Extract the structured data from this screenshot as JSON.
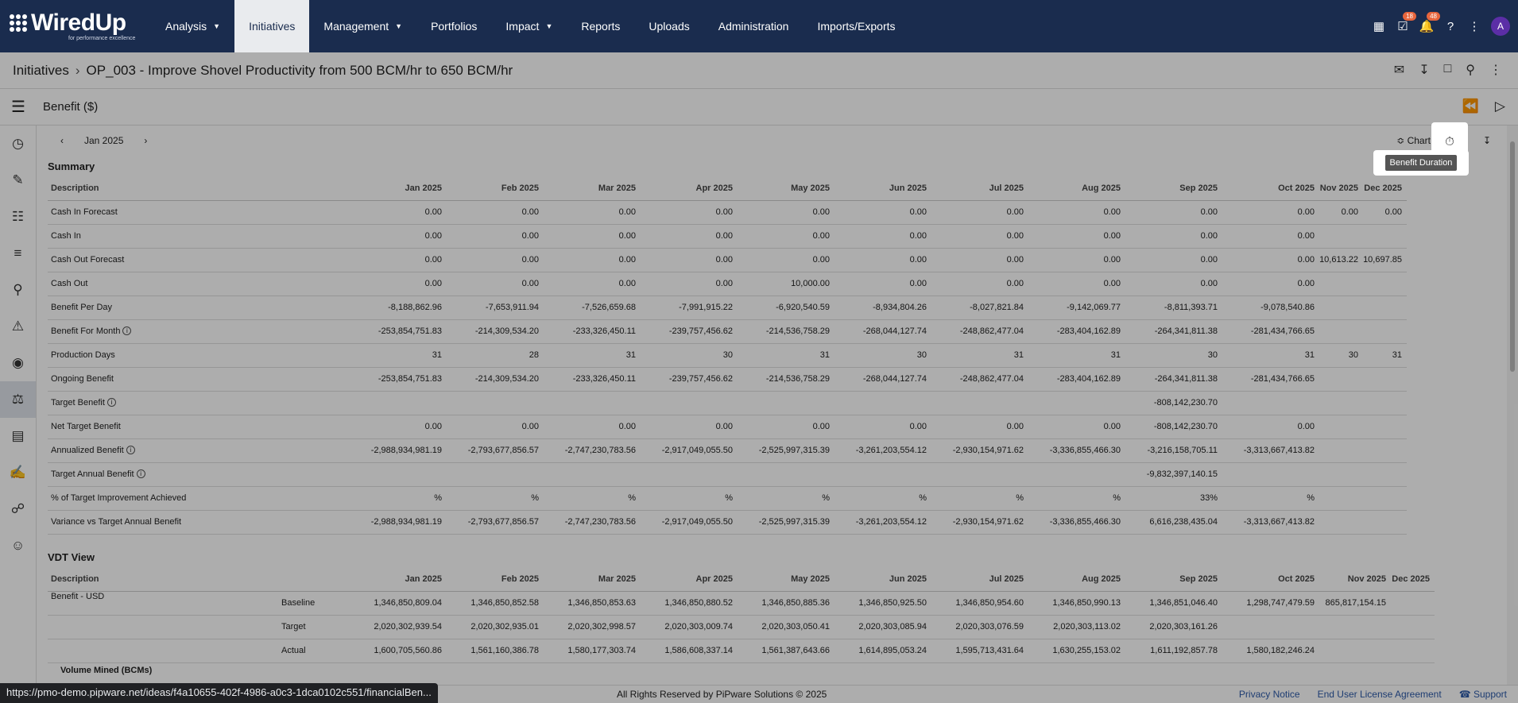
{
  "app": {
    "logo": "WiredUp",
    "tagline": "for performance excellence"
  },
  "nav": [
    {
      "label": "Analysis",
      "caret": true
    },
    {
      "label": "Initiatives",
      "caret": false,
      "active": true
    },
    {
      "label": "Management",
      "caret": true
    },
    {
      "label": "Portfolios",
      "caret": false
    },
    {
      "label": "Impact",
      "caret": true
    },
    {
      "label": "Reports",
      "caret": false
    },
    {
      "label": "Uploads",
      "caret": false
    },
    {
      "label": "Administration",
      "caret": false
    },
    {
      "label": "Imports/Exports",
      "caret": false
    }
  ],
  "top_icons": {
    "tasks_badge": "18",
    "alerts_badge": "48",
    "avatar": "A"
  },
  "breadcrumb": {
    "root": "Initiatives",
    "current": "OP_003 - Improve Shovel Productivity from 500 BCM/hr to 650 BCM/hr"
  },
  "subbar": {
    "title": "Benefit ($)"
  },
  "period": {
    "label": "Jan 2025"
  },
  "toolbar": {
    "chart_label": "Chart",
    "tooltip": "Benefit Duration"
  },
  "summary": {
    "title": "Summary",
    "columns": [
      "Description",
      "Jan 2025",
      "Feb 2025",
      "Mar 2025",
      "Apr 2025",
      "May 2025",
      "Jun 2025",
      "Jul 2025",
      "Aug 2025",
      "Sep 2025",
      "Oct 2025",
      "Nov 2025",
      "Dec 2025"
    ],
    "rows": [
      {
        "label": "Cash In Forecast",
        "info": false,
        "values": [
          "0.00",
          "0.00",
          "0.00",
          "0.00",
          "0.00",
          "0.00",
          "0.00",
          "0.00",
          "0.00",
          "0.00",
          "0.00",
          "0.00"
        ]
      },
      {
        "label": "Cash In",
        "info": false,
        "values": [
          "0.00",
          "0.00",
          "0.00",
          "0.00",
          "0.00",
          "0.00",
          "0.00",
          "0.00",
          "0.00",
          "0.00",
          "",
          ""
        ]
      },
      {
        "label": "Cash Out Forecast",
        "info": false,
        "values": [
          "0.00",
          "0.00",
          "0.00",
          "0.00",
          "0.00",
          "0.00",
          "0.00",
          "0.00",
          "0.00",
          "0.00",
          "10,613.22",
          "10,697.85"
        ]
      },
      {
        "label": "Cash Out",
        "info": false,
        "values": [
          "0.00",
          "0.00",
          "0.00",
          "0.00",
          "10,000.00",
          "0.00",
          "0.00",
          "0.00",
          "0.00",
          "0.00",
          "",
          ""
        ]
      },
      {
        "label": "Benefit Per Day",
        "info": false,
        "values": [
          "-8,188,862.96",
          "-7,653,911.94",
          "-7,526,659.68",
          "-7,991,915.22",
          "-6,920,540.59",
          "-8,934,804.26",
          "-8,027,821.84",
          "-9,142,069.77",
          "-8,811,393.71",
          "-9,078,540.86",
          "",
          ""
        ]
      },
      {
        "label": "Benefit For Month",
        "info": true,
        "values": [
          "-253,854,751.83",
          "-214,309,534.20",
          "-233,326,450.11",
          "-239,757,456.62",
          "-214,536,758.29",
          "-268,044,127.74",
          "-248,862,477.04",
          "-283,404,162.89",
          "-264,341,811.38",
          "-281,434,766.65",
          "",
          ""
        ]
      },
      {
        "label": "Production Days",
        "info": false,
        "values": [
          "31",
          "28",
          "31",
          "30",
          "31",
          "30",
          "31",
          "31",
          "30",
          "31",
          "30",
          "31"
        ]
      },
      {
        "label": "Ongoing Benefit",
        "info": false,
        "values": [
          "-253,854,751.83",
          "-214,309,534.20",
          "-233,326,450.11",
          "-239,757,456.62",
          "-214,536,758.29",
          "-268,044,127.74",
          "-248,862,477.04",
          "-283,404,162.89",
          "-264,341,811.38",
          "-281,434,766.65",
          "",
          ""
        ]
      },
      {
        "label": "Target Benefit",
        "info": true,
        "values": [
          "",
          "",
          "",
          "",
          "",
          "",
          "",
          "",
          "-808,142,230.70",
          "",
          "",
          ""
        ]
      },
      {
        "label": "Net Target Benefit",
        "info": false,
        "values": [
          "0.00",
          "0.00",
          "0.00",
          "0.00",
          "0.00",
          "0.00",
          "0.00",
          "0.00",
          "-808,142,230.70",
          "0.00",
          "",
          ""
        ]
      },
      {
        "label": "Annualized Benefit",
        "info": true,
        "values": [
          "-2,988,934,981.19",
          "-2,793,677,856.57",
          "-2,747,230,783.56",
          "-2,917,049,055.50",
          "-2,525,997,315.39",
          "-3,261,203,554.12",
          "-2,930,154,971.62",
          "-3,336,855,466.30",
          "-3,216,158,705.11",
          "-3,313,667,413.82",
          "",
          ""
        ]
      },
      {
        "label": "Target Annual Benefit",
        "info": true,
        "values": [
          "",
          "",
          "",
          "",
          "",
          "",
          "",
          "",
          "-9,832,397,140.15",
          "",
          "",
          ""
        ]
      },
      {
        "label": "% of Target Improvement Achieved",
        "info": false,
        "values": [
          "%",
          "%",
          "%",
          "%",
          "%",
          "%",
          "%",
          "%",
          "33%",
          "%",
          "",
          ""
        ]
      },
      {
        "label": "Variance vs Target Annual Benefit",
        "info": false,
        "values": [
          "-2,988,934,981.19",
          "-2,793,677,856.57",
          "-2,747,230,783.56",
          "-2,917,049,055.50",
          "-2,525,997,315.39",
          "-3,261,203,554.12",
          "-2,930,154,971.62",
          "-3,336,855,466.30",
          "6,616,238,435.04",
          "-3,313,667,413.82",
          "",
          ""
        ]
      }
    ]
  },
  "vdt": {
    "title": "VDT View",
    "columns": [
      "Description",
      "",
      "Jan 2025",
      "Feb 2025",
      "Mar 2025",
      "Apr 2025",
      "May 2025",
      "Jun 2025",
      "Jul 2025",
      "Aug 2025",
      "Sep 2025",
      "Oct 2025",
      "Nov 2025",
      "Dec 2025"
    ],
    "group": "Benefit - USD",
    "rows": [
      {
        "label": "Baseline",
        "values": [
          "1,346,850,809.04",
          "1,346,850,852.58",
          "1,346,850,853.63",
          "1,346,850,880.52",
          "1,346,850,885.36",
          "1,346,850,925.50",
          "1,346,850,954.60",
          "1,346,850,990.13",
          "1,346,851,046.40",
          "1,298,747,479.59",
          "865,817,154.15",
          ""
        ]
      },
      {
        "label": "Target",
        "values": [
          "2,020,302,939.54",
          "2,020,302,935.01",
          "2,020,302,998.57",
          "2,020,303,009.74",
          "2,020,303,050.41",
          "2,020,303,085.94",
          "2,020,303,076.59",
          "2,020,303,113.02",
          "2,020,303,161.26",
          "",
          "",
          ""
        ]
      },
      {
        "label": "Actual",
        "values": [
          "1,600,705,560.86",
          "1,561,160,386.78",
          "1,580,177,303.74",
          "1,586,608,337.14",
          "1,561,387,643.66",
          "1,614,895,053.24",
          "1,595,713,431.64",
          "1,630,255,153.02",
          "1,611,192,857.78",
          "1,580,182,246.24",
          "",
          ""
        ]
      }
    ],
    "partial_row": "Volume Mined (BCMs)"
  },
  "footer": {
    "copyright": "All Rights Reserved by PiPware Solutions © 2025",
    "privacy": "Privacy Notice",
    "eula": "End User License Agreement",
    "support": "Support"
  },
  "status_url": "https://pmo-demo.pipware.net/ideas/f4a10655-402f-4986-a0c3-1dca0102c551/financialBen..."
}
